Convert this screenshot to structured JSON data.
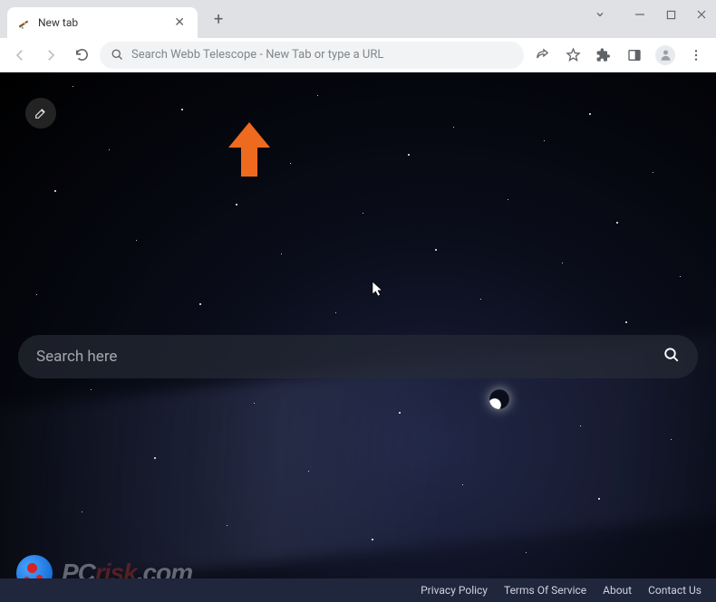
{
  "tab": {
    "title": "New tab"
  },
  "omnibox": {
    "placeholder": "Search Webb Telescope - New Tab or type a URL"
  },
  "page": {
    "search_placeholder": "Search here"
  },
  "footer": {
    "links": [
      "Privacy Policy",
      "Terms Of Service",
      "About",
      "Contact Us"
    ]
  },
  "watermark": {
    "text_a": "PC",
    "text_b": "risk",
    "text_c": ".com"
  }
}
